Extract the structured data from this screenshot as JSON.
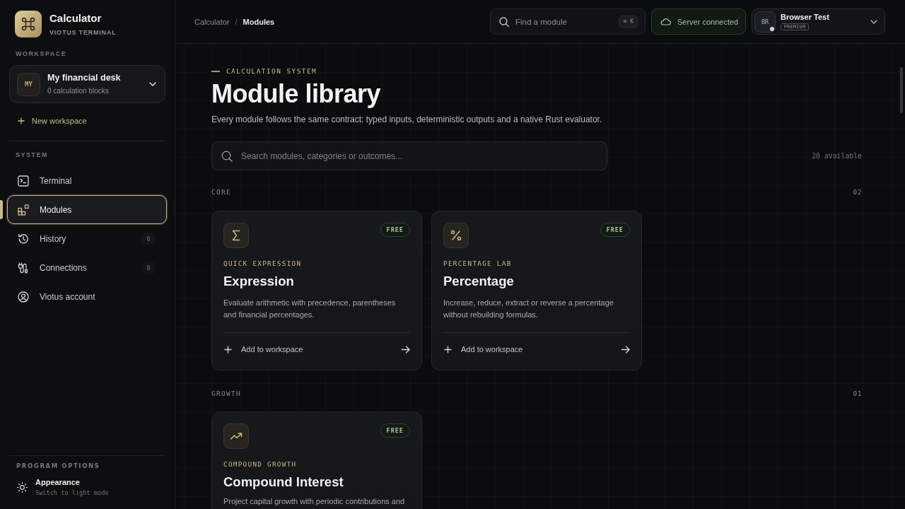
{
  "sidebar": {
    "brand": {
      "title": "Calculator",
      "subtitle": "VIOTUS TERMINAL"
    },
    "workspace_label": "WORKSPACE",
    "workspace": {
      "initials": "MY",
      "name": "My financial desk",
      "detail": "0 calculation blocks"
    },
    "new_workspace": "New workspace",
    "system_label": "SYSTEM",
    "items": [
      {
        "label": "Terminal",
        "selected": false
      },
      {
        "label": "Modules",
        "selected": true
      },
      {
        "label": "History",
        "count": "0",
        "selected": false
      },
      {
        "label": "Connections",
        "count": "0",
        "selected": false
      },
      {
        "label": "Viotus account",
        "selected": false
      }
    ],
    "options_label": "PROGRAM OPTIONS",
    "appearance": {
      "title": "Appearance",
      "hint": "Switch to light mode"
    }
  },
  "topbar": {
    "breadcrumb": [
      "Calculator",
      "Modules"
    ],
    "separator": "/",
    "search": {
      "placeholder": "Find a module",
      "shortcut": "⌘ K"
    },
    "status": "Server connected",
    "user": {
      "initials": "BR",
      "name": "Browser Test",
      "plan": "PREMIUM"
    }
  },
  "page": {
    "eyebrow": "CALCULATION SYSTEM",
    "title": "Module library",
    "description": "Every module follows the same contract: typed inputs, deterministic outputs and a native Rust evaluator.",
    "search": {
      "placeholder": "Search modules, categories or outcomes..."
    },
    "available": "20 available",
    "sections": [
      {
        "name": "CORE",
        "count": "02",
        "modules": [
          {
            "badge": "FREE",
            "kicker": "QUICK EXPRESSION",
            "title": "Expression",
            "description": "Evaluate arithmetic with precedence, parentheses and financial percentages.",
            "action": "Add to workspace"
          },
          {
            "badge": "FREE",
            "kicker": "PERCENTAGE LAB",
            "title": "Percentage",
            "description": "Increase, reduce, extract or reverse a percentage without rebuilding formulas.",
            "action": "Add to workspace"
          }
        ]
      },
      {
        "name": "GROWTH",
        "count": "01",
        "modules": [
          {
            "badge": "FREE",
            "kicker": "COMPOUND GROWTH",
            "title": "Compound Interest",
            "description": "Project capital growth with periodic contributions and"
          }
        ]
      }
    ]
  }
}
